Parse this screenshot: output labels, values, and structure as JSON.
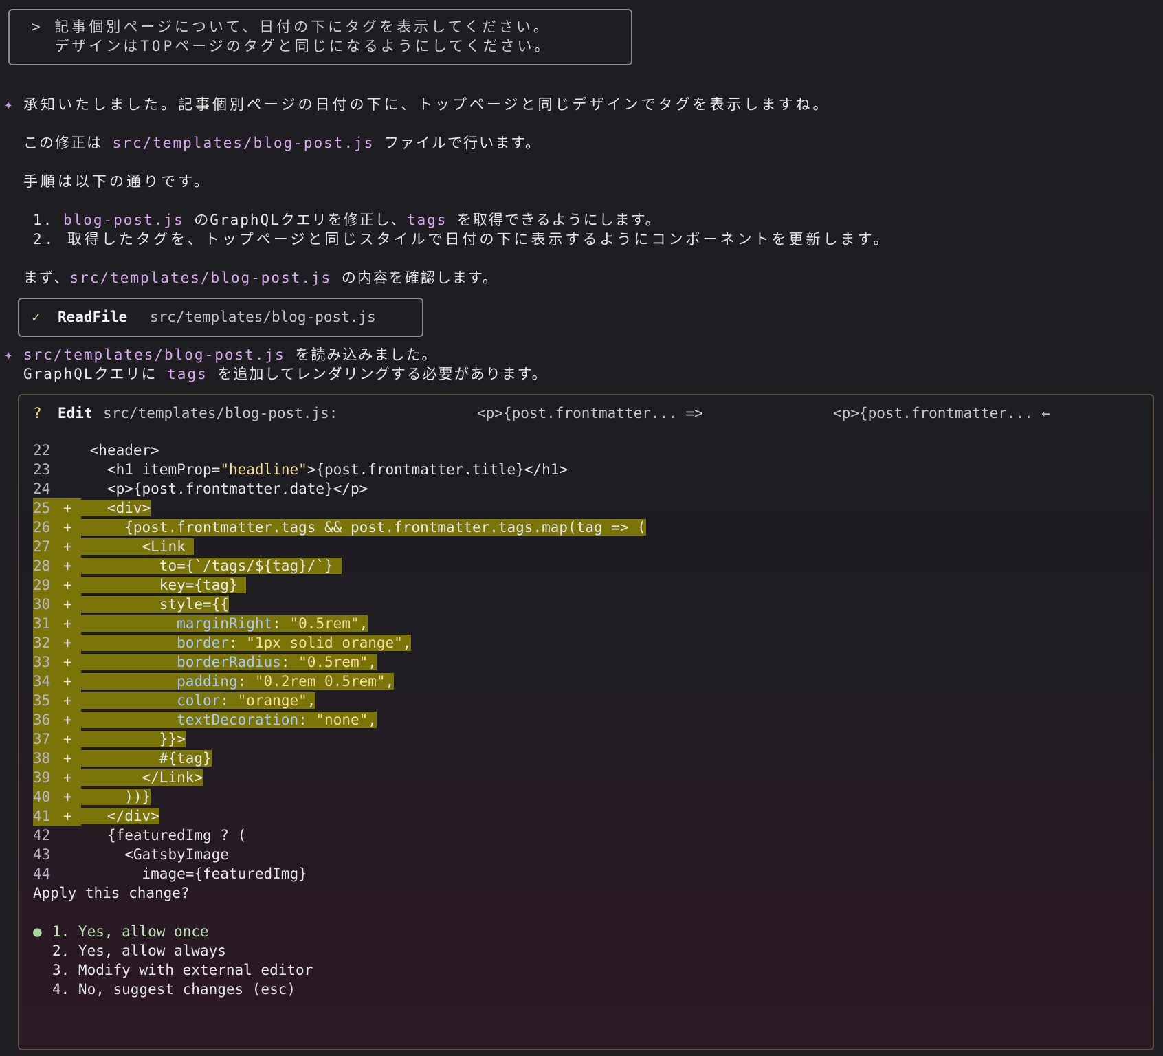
{
  "user_prompt": {
    "line1": "> 記事個別ページについて、日付の下にタグを表示してください。",
    "line2": "  デザインはTOPページのタグと同じになるようにしてください。"
  },
  "assistant": {
    "msg1": "承知いたしました。記事個別ページの日付の下に、トップページと同じデザインでタグを表示しますね。",
    "msg2_pre": "この修正は ",
    "msg2_path": "src/templates/blog-post.js",
    "msg2_post": " ファイルで行います。",
    "msg3": "手順は以下の通りです。",
    "step1_num": "1. ",
    "step1_file": "blog-post.js",
    "step1_mid": " のGraphQLクエリを修正し、",
    "step1_tags": "tags",
    "step1_post": " を取得できるようにします。",
    "step2": "2. 取得したタグを、トップページと同じスタイルで日付の下に表示するようにコンポーネントを更新します。",
    "msg4_pre": "まず、",
    "msg4_path": "src/templates/blog-post.js",
    "msg4_post": " の内容を確認します。",
    "msg5_path": "src/templates/blog-post.js",
    "msg5_post": " を読み込みました。",
    "msg6_pre": "GraphQLクエリに ",
    "msg6_tags": "tags",
    "msg6_post": " を追加してレンダリングする必要があります。"
  },
  "readfile": {
    "check": "✓",
    "tool": "ReadFile",
    "path": "src/templates/blog-post.js"
  },
  "edit": {
    "marker": "?",
    "tool": "Edit",
    "path": "src/templates/blog-post.js:",
    "from": "<p>{post.frontmatter... =>",
    "to": "<p>{post.frontmatter... ←"
  },
  "code_lines": [
    {
      "num": "22",
      "sym": "",
      "text": "<header>",
      "added": false
    },
    {
      "num": "23",
      "sym": "",
      "text": "  <h1 itemProp=\"headline\">{post.frontmatter.title}</h1>",
      "added": false
    },
    {
      "num": "24",
      "sym": "",
      "text": "  <p>{post.frontmatter.date}</p>",
      "added": false
    },
    {
      "num": "25",
      "sym": "+",
      "text": "  <div>",
      "added": true
    },
    {
      "num": "26",
      "sym": "+",
      "text": "    {post.frontmatter.tags && post.frontmatter.tags.map(tag => (",
      "added": true
    },
    {
      "num": "27",
      "sym": "+",
      "text": "      <Link ",
      "added": true
    },
    {
      "num": "28",
      "sym": "+",
      "text": "        to={`/tags/${tag}/`} ",
      "added": true
    },
    {
      "num": "29",
      "sym": "+",
      "text": "        key={tag} ",
      "added": true
    },
    {
      "num": "30",
      "sym": "+",
      "text": "        style={{",
      "added": true
    },
    {
      "num": "31",
      "sym": "+",
      "text": "          marginRight: \"0.5rem\",",
      "added": true
    },
    {
      "num": "32",
      "sym": "+",
      "text": "          border: \"1px solid orange\",",
      "added": true
    },
    {
      "num": "33",
      "sym": "+",
      "text": "          borderRadius: \"0.5rem\",",
      "added": true
    },
    {
      "num": "34",
      "sym": "+",
      "text": "          padding: \"0.2rem 0.5rem\",",
      "added": true
    },
    {
      "num": "35",
      "sym": "+",
      "text": "          color: \"orange\",",
      "added": true
    },
    {
      "num": "36",
      "sym": "+",
      "text": "          textDecoration: \"none\",",
      "added": true
    },
    {
      "num": "37",
      "sym": "+",
      "text": "        }}>",
      "added": true
    },
    {
      "num": "38",
      "sym": "+",
      "text": "        #{tag}",
      "added": true
    },
    {
      "num": "39",
      "sym": "+",
      "text": "      </Link>",
      "added": true
    },
    {
      "num": "40",
      "sym": "+",
      "text": "    ))}",
      "added": true
    },
    {
      "num": "41",
      "sym": "+",
      "text": "  </div>",
      "added": true
    },
    {
      "num": "42",
      "sym": "",
      "text": "  {featuredImg ? (",
      "added": false
    },
    {
      "num": "43",
      "sym": "",
      "text": "    <GatsbyImage",
      "added": false
    },
    {
      "num": "44",
      "sym": "",
      "text": "      image={featuredImg}",
      "added": false
    }
  ],
  "question": "Apply this change?",
  "options": [
    {
      "label": "1. Yes, allow once",
      "selected": true
    },
    {
      "label": "2. Yes, allow always",
      "selected": false
    },
    {
      "label": "3. Modify with external editor",
      "selected": false
    },
    {
      "label": "4. No, suggest changes (esc)",
      "selected": false
    }
  ],
  "selected_dot": "●",
  "sparkle": "✦"
}
